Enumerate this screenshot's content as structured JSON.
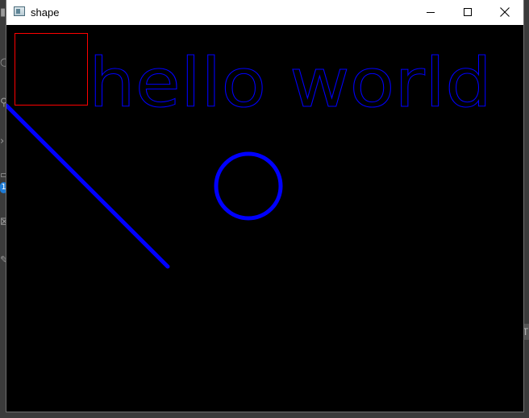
{
  "window": {
    "title": "shape",
    "icon": "app-window-icon",
    "controls": [
      "minimize-icon",
      "maximize-icon",
      "close-icon"
    ]
  },
  "canvas": {
    "background_color": "#000000",
    "text": "hello world",
    "text_color": "#0000ff",
    "shapes": [
      {
        "kind": "rectangle",
        "color": "#ff0000",
        "outline": "thin"
      },
      {
        "kind": "line",
        "color": "#0000ff",
        "outline": "thick"
      },
      {
        "kind": "circle",
        "color": "#0000ff",
        "outline": "thick"
      }
    ]
  },
  "background": {
    "badge": "1",
    "edge_glyph": "T"
  }
}
